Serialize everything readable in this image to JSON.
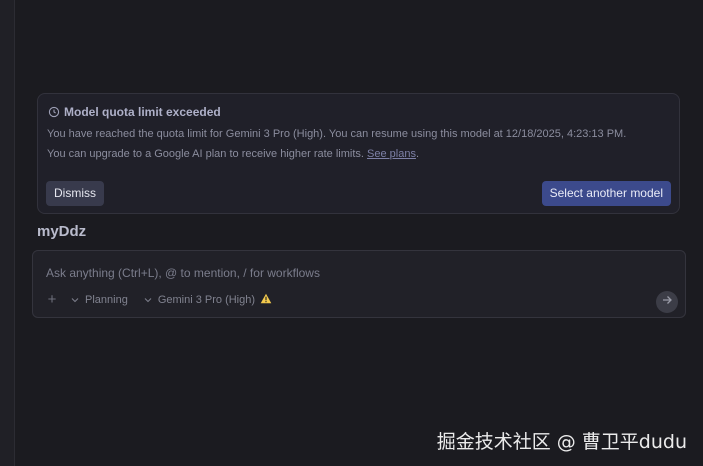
{
  "quota_card": {
    "title": "Model quota limit exceeded",
    "message_line1": "You have reached the quota limit for Gemini 3 Pro (High). You can resume using this model at 12/18/2025, 4:23:13 PM.",
    "message_line2_prefix": "You can upgrade to a Google AI plan to receive higher rate limits. ",
    "link_label": "See plans",
    "message_line2_suffix": ".",
    "dismiss_label": "Dismiss",
    "select_label": "Select another model"
  },
  "workspace": {
    "name": "myDdz"
  },
  "chat": {
    "placeholder": "Ask anything (Ctrl+L), @ to mention, / for workflows",
    "mode_label": "Planning",
    "model_label": "Gemini 3 Pro (High)",
    "warning_icon": "warning-icon",
    "send_icon": "arrow-right-icon"
  },
  "watermark": {
    "text": "掘金技术社区 @ 曹卫平dudu"
  },
  "colors": {
    "background": "#1b1b20",
    "primary_button": "#3c4a8c",
    "warning": "#f2c94c"
  }
}
